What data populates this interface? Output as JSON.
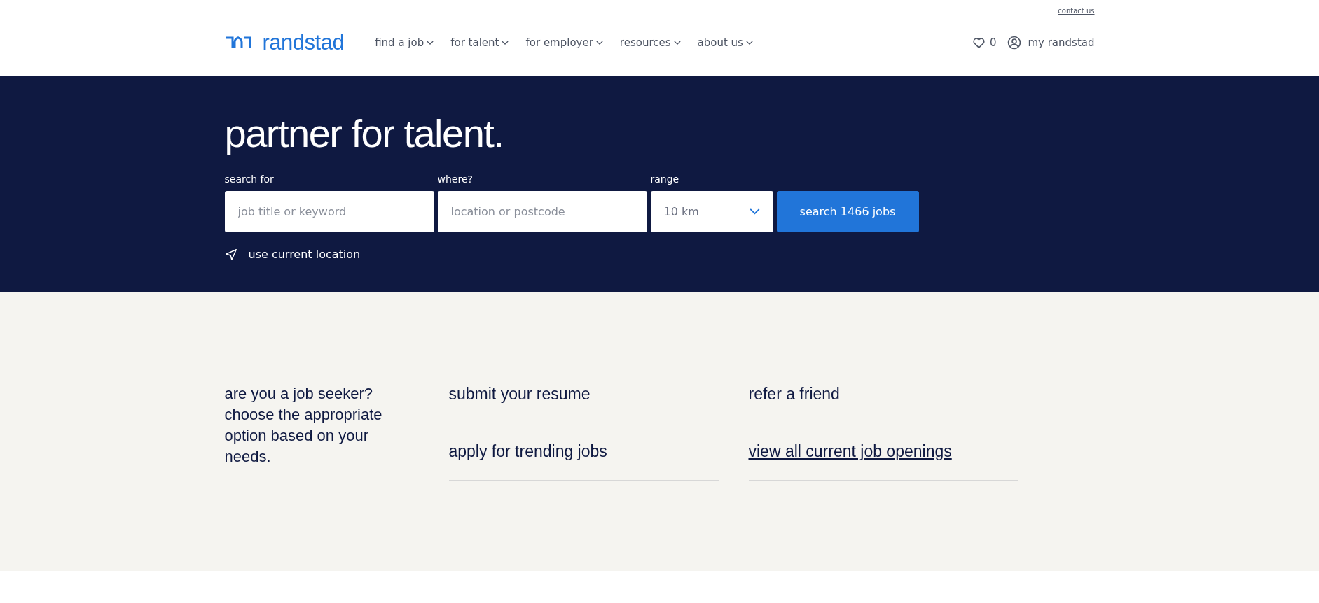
{
  "header": {
    "contact_link": "contact us",
    "logo": {
      "text": "randstad"
    },
    "nav": [
      {
        "label": "find a job"
      },
      {
        "label": "for talent"
      },
      {
        "label": "for employer"
      },
      {
        "label": "resources"
      },
      {
        "label": "about us"
      }
    ],
    "favorites": {
      "count": "0"
    },
    "account": {
      "label": "my randstad"
    }
  },
  "hero": {
    "title": "partner for talent.",
    "fields": [
      {
        "kind": "text",
        "label": "search for",
        "placeholder": "job title or keyword"
      },
      {
        "kind": "text",
        "label": "where?",
        "placeholder": "location or postcode"
      },
      {
        "kind": "select",
        "label": "range",
        "value": "10 km"
      }
    ],
    "search_button": "search 1466 jobs",
    "location_link": "use current location"
  },
  "options": {
    "intro": "are you a job seeker? choose the appropriate option based on your needs.",
    "columns": [
      [
        {
          "label": "submit your resume",
          "underlined": false
        },
        {
          "label": "apply for trending jobs",
          "underlined": false
        }
      ],
      [
        {
          "label": "refer a friend",
          "underlined": false
        },
        {
          "label": "view all current job openings",
          "underlined": true
        }
      ]
    ]
  }
}
